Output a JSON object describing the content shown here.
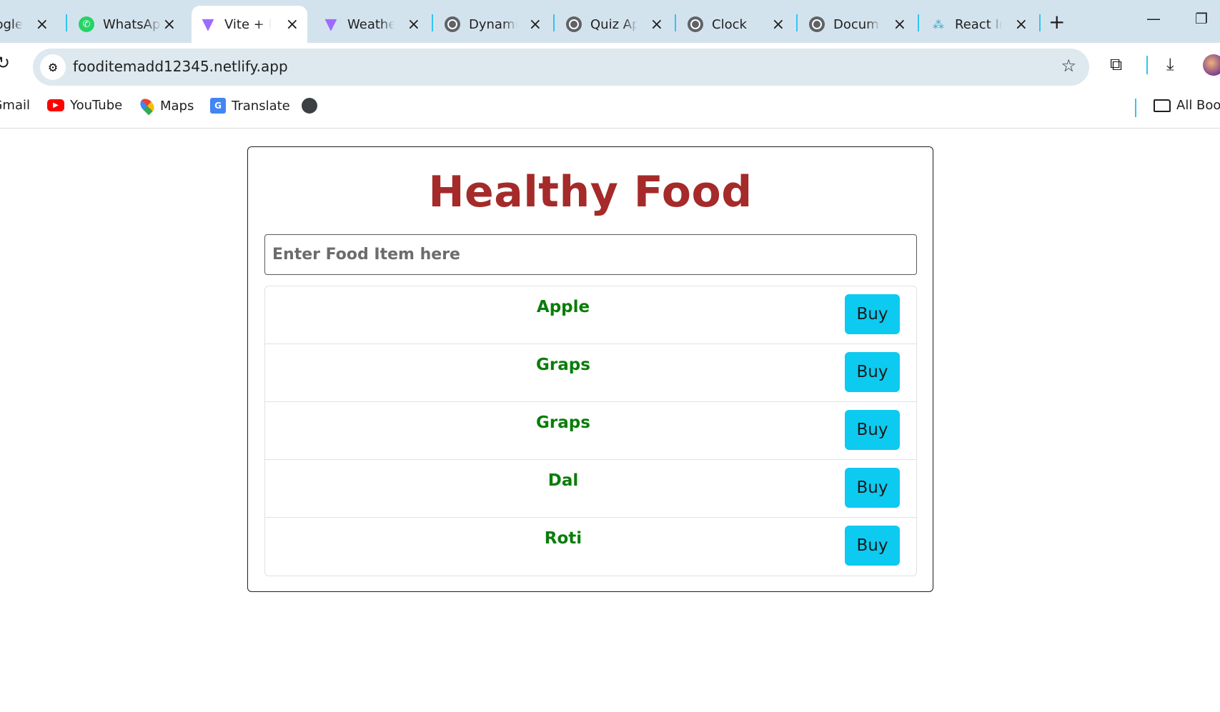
{
  "browser": {
    "tabs": [
      {
        "title": "Google",
        "icon": "globe-icon"
      },
      {
        "title": "WhatsApp",
        "icon": "whatsapp-icon"
      },
      {
        "title": "Vite + React",
        "icon": "vite-icon",
        "active": true
      },
      {
        "title": "Weather",
        "icon": "vite-icon"
      },
      {
        "title": "Dynamic",
        "icon": "globe-icon"
      },
      {
        "title": "Quiz App",
        "icon": "globe-icon"
      },
      {
        "title": "Clock",
        "icon": "globe-icon"
      },
      {
        "title": "Document",
        "icon": "globe-icon"
      },
      {
        "title": "React In",
        "icon": "react-icon"
      }
    ],
    "url": "fooditemadd12345.netlify.app",
    "bookmarks": [
      {
        "label": "Gmail"
      },
      {
        "label": "YouTube",
        "icon": "youtube-icon"
      },
      {
        "label": "Maps",
        "icon": "maps-icon"
      },
      {
        "label": "Translate",
        "icon": "translate-icon"
      }
    ],
    "all_bookmarks": "All Bookmarks"
  },
  "page": {
    "title": "Healthy Food",
    "input_placeholder": "Enter Food Item here",
    "buy_label": "Buy",
    "items": [
      "Apple",
      "Graps",
      "Graps",
      "Dal",
      "Roti"
    ],
    "colors": {
      "title": "#a52a2a",
      "item": "#0a7d0a",
      "button": "#0dcaf0"
    }
  }
}
